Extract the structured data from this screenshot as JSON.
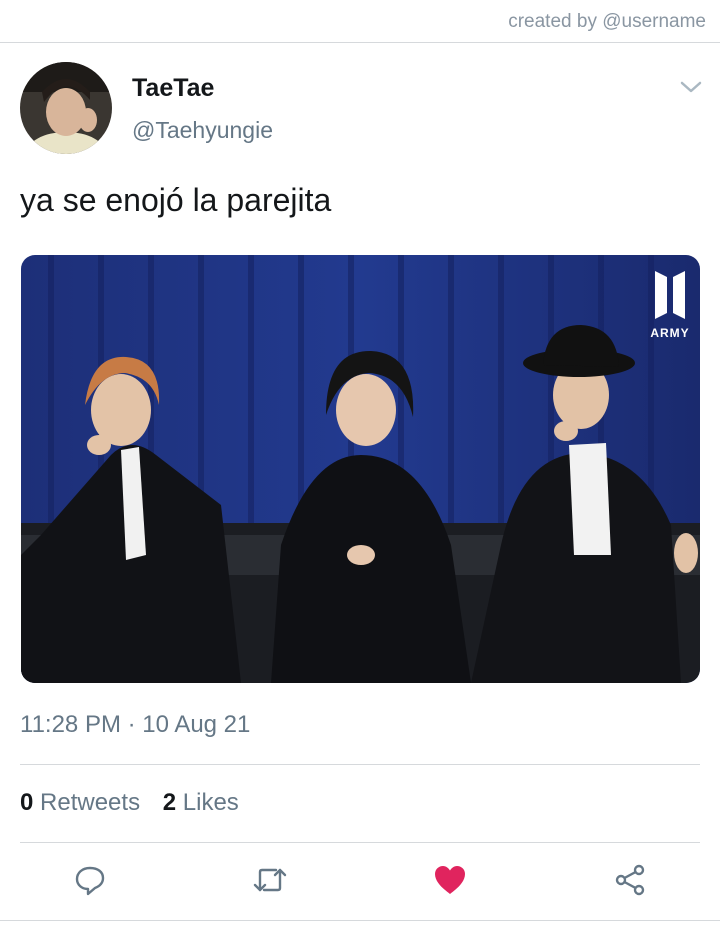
{
  "header": {
    "credit": "created by @username"
  },
  "tweet": {
    "display_name": "TaeTae",
    "handle": "@Taehyungie",
    "text": "ya se enojó la parejita",
    "media_watermark": "ARMY",
    "timestamp": "11:28 PM · 10 Aug 21",
    "retweets_count": "0",
    "retweets_label": "Retweets",
    "likes_count": "2",
    "likes_label": "Likes"
  },
  "actions": [
    {
      "icon": "reply-icon"
    },
    {
      "icon": "retweet-icon"
    },
    {
      "icon": "like-icon",
      "liked": true,
      "color": "#e0245e"
    },
    {
      "icon": "share-icon"
    }
  ],
  "colors": {
    "secondary_text": "#657786",
    "divider": "#d6d9dc",
    "like": "#e0245e"
  }
}
